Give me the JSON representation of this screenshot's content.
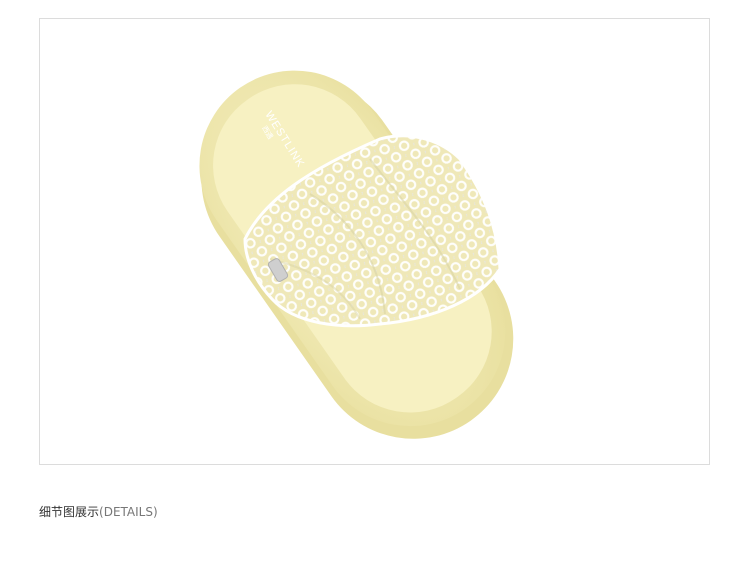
{
  "product_image": {
    "logo_text": "WESTLINK",
    "logo_subtext": "西遇",
    "colors": {
      "sole": "#f2ecb0",
      "footbed": "#f6f0bf",
      "mesh": "#f7f7f2",
      "frame_border": "#dcdcdc"
    }
  },
  "caption": {
    "main": "细节图展示",
    "sub": "(DETAILS)"
  }
}
